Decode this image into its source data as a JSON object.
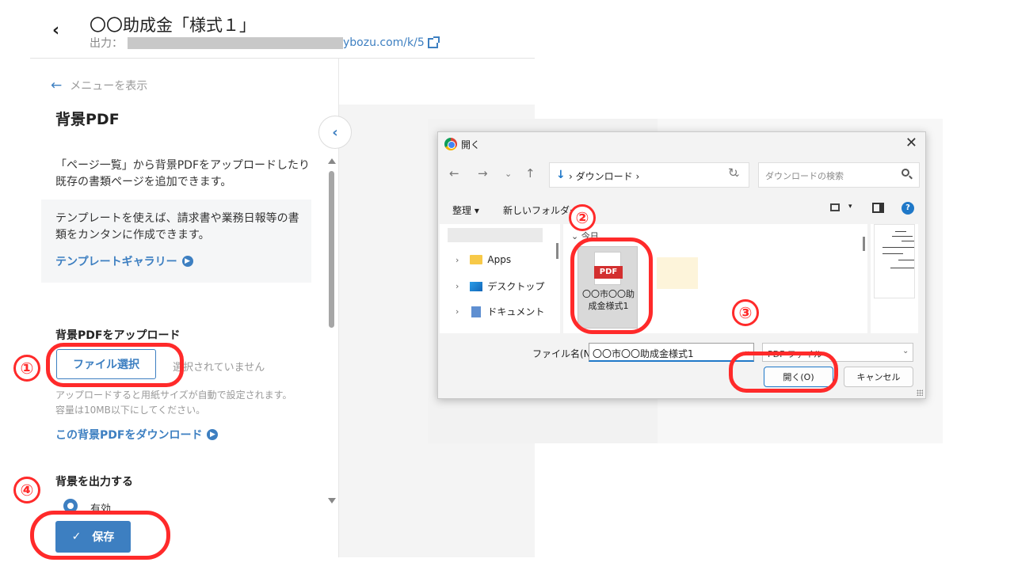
{
  "header": {
    "back_glyph": "‹",
    "title": "〇〇助成金「様式１」",
    "output_label": "出力：",
    "output_url_visible": "ybozu.com/k/5"
  },
  "sidebar": {
    "menu_link": "メニューを表示",
    "section_title": "背景PDF",
    "description": "「ページ一覧」から背景PDFをアップロードしたり既存の書類ページを追加できます。",
    "template_text": "テンプレートを使えば、請求書や業務日報等の書類をカンタンに作成できます。",
    "template_link": "テンプレートギャラリー",
    "upload_title": "背景PDFをアップロード",
    "file_button": "ファイル選択",
    "no_file_text": "選択されていません",
    "upload_note": "アップロードすると用紙サイズが自動で設定されます。容量は10MB以下にしてください。",
    "download_link": "この背景PDFをダウンロード",
    "bg_output_title": "背景を出力する",
    "radio_label": "有効",
    "save_button": "保存"
  },
  "dialog": {
    "title": "開く",
    "close_glyph": "✕",
    "path": "ダウンロード ›",
    "search_placeholder": "ダウンロードの検索",
    "organize": "整理 ▾",
    "new_folder": "新しいフォルダー",
    "help": "?",
    "group_today": "今日",
    "tree": [
      {
        "label": "Apps",
        "icon": "folder-icon"
      },
      {
        "label": "デスクトップ",
        "icon": "desktop-icon"
      },
      {
        "label": "ドキュメント",
        "icon": "documents-icon"
      }
    ],
    "file": {
      "badge": "PDF",
      "name": "〇〇市〇〇助成金様式1"
    },
    "filename_label": "ファイル名(N):",
    "filename_value": "〇〇市〇〇助成金様式1",
    "filetype": "PDF ファイル",
    "open_button": "開く(O)",
    "cancel_button": "キャンセル"
  },
  "annotations": {
    "step1": "①",
    "step2": "②",
    "step3": "③",
    "step4": "④",
    "color": "#ff2a2a"
  },
  "colors": {
    "accent": "#3d7fc1",
    "windows_blue": "#1f78c8"
  }
}
